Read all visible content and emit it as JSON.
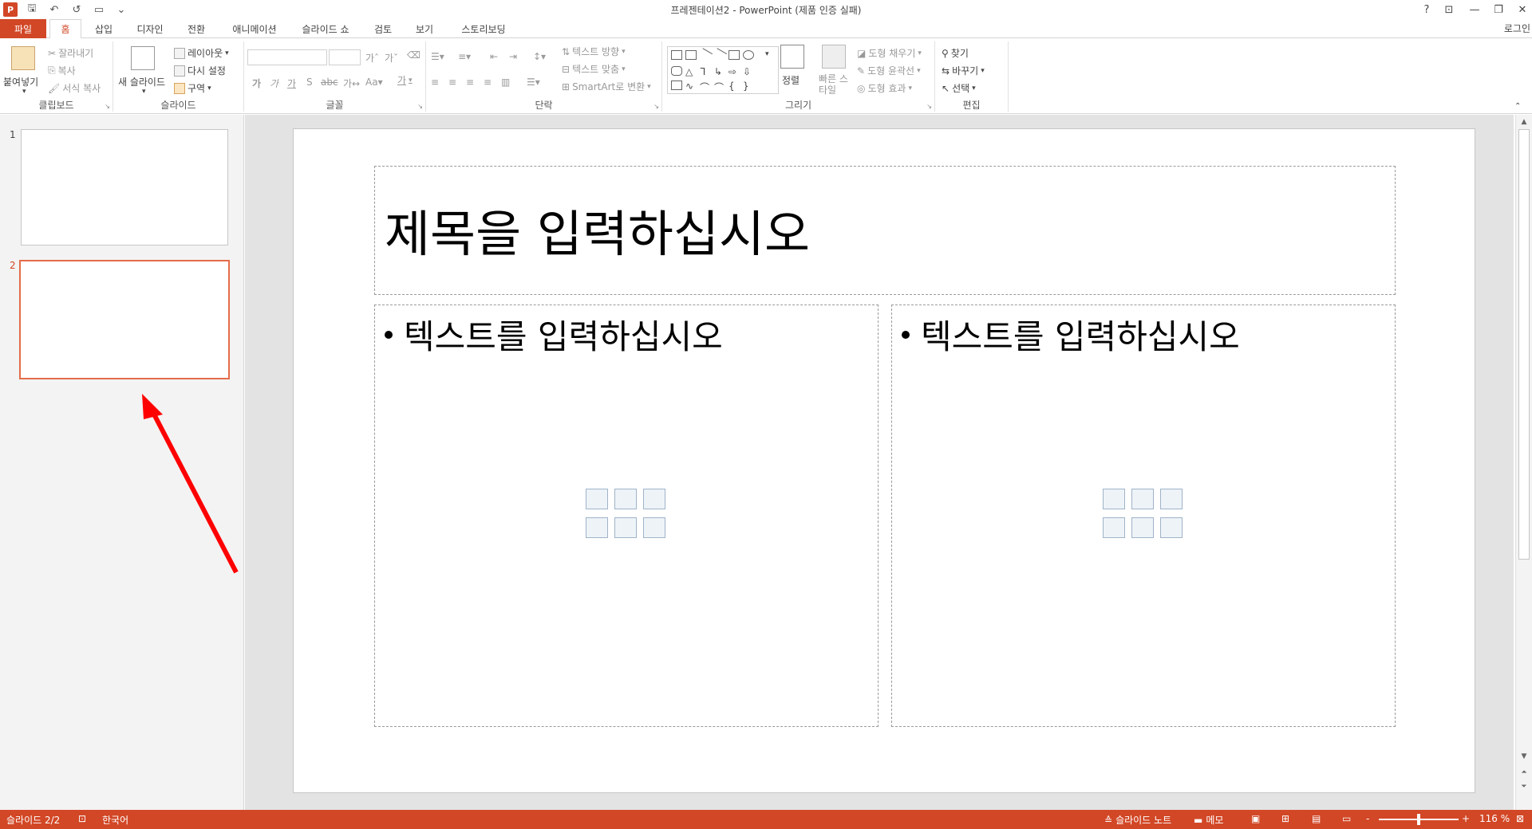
{
  "titlebar": {
    "title": "프레젠테이션2 - PowerPoint (제품 인증 실패)",
    "help": "?",
    "qat": {
      "logo": "P",
      "save": "🖫",
      "undo": "↶",
      "redo": "↺"
    }
  },
  "tabs": [
    {
      "label": "파일"
    },
    {
      "label": "홈"
    },
    {
      "label": "삽입"
    },
    {
      "label": "디자인"
    },
    {
      "label": "전환"
    },
    {
      "label": "애니메이션"
    },
    {
      "label": "슬라이드 쇼"
    },
    {
      "label": "검토"
    },
    {
      "label": "보기"
    },
    {
      "label": "스토리보딩"
    }
  ],
  "signin": "로그인",
  "ribbon": {
    "clipboard": {
      "label": "클립보드",
      "paste": "붙여넣기",
      "cut": "잘라내기",
      "copy": "복사",
      "format_painter": "서식 복사"
    },
    "slides": {
      "label": "슬라이드",
      "new_slide": "새 슬라이드",
      "layout": "레이아웃",
      "reset": "다시 설정",
      "section": "구역"
    },
    "font": {
      "label": "글꼴",
      "font_color": "가"
    },
    "paragraph": {
      "label": "단락",
      "text_direction": "텍스트 방향",
      "align_text": "텍스트 맞춤",
      "smartart": "SmartArt로 변환"
    },
    "drawing": {
      "label": "그리기",
      "arrange": "정렬",
      "quick_styles": "빠른 스타일",
      "shape_fill": "도형 채우기",
      "shape_outline": "도형 윤곽선",
      "shape_effects": "도형 효과"
    },
    "editing": {
      "label": "편집",
      "find": "찾기",
      "replace": "바꾸기",
      "select": "선택"
    }
  },
  "thumbnails": [
    {
      "number": "1"
    },
    {
      "number": "2"
    }
  ],
  "slide": {
    "title_placeholder": "제목을 입력하십시오",
    "left_content": "텍스트를 입력하십시오",
    "right_content": "텍스트를 입력하십시오"
  },
  "statusbar": {
    "slide_count": "슬라이드 2/2",
    "language": "한국어",
    "notes": "슬라이드 노트",
    "comments": "메모",
    "zoom_level": "116 %",
    "zoom_minus": "-",
    "zoom_plus": "+"
  },
  "colors": {
    "accent": "#d24726",
    "selection": "#e46c4a",
    "arrow": "#ff0000"
  }
}
